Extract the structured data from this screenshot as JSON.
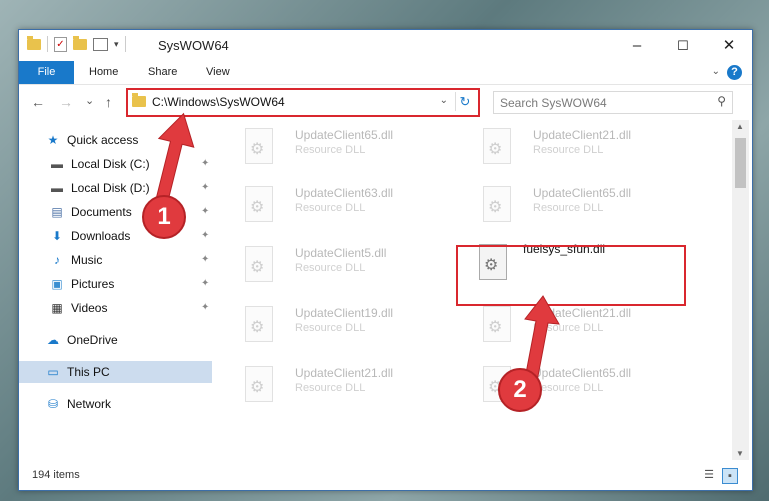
{
  "window": {
    "title": "SysWOW64",
    "minimize_glyph": "–",
    "maximize_glyph": "☐",
    "close_glyph": "✕"
  },
  "quick_access_toolbar": {
    "icons": [
      "folder-icon",
      "properties-check-icon",
      "new-folder-icon",
      "properties-icon",
      "customize-dropdown-icon"
    ]
  },
  "ribbon": {
    "tabs": [
      "File",
      "Home",
      "Share",
      "View"
    ],
    "help_glyph": "?",
    "expand_glyph": "⌄"
  },
  "navigation": {
    "back_glyph": "←",
    "forward_glyph": "→",
    "recent_glyph": "⌄",
    "up_glyph": "↑",
    "address": "C:\\Windows\\SysWOW64",
    "refresh_glyph": "↻",
    "search_placeholder": "Search SysWOW64",
    "search_glyph": "⚲"
  },
  "sidebar": {
    "items": [
      {
        "label": "Quick access",
        "icon": "star-icon",
        "glyph": "★",
        "pinned": false,
        "level": 0
      },
      {
        "label": "Local Disk (C:)",
        "icon": "drive-icon",
        "glyph": "▬",
        "pinned": true,
        "level": 1
      },
      {
        "label": "Local Disk (D:)",
        "icon": "drive-icon",
        "glyph": "▬",
        "pinned": true,
        "level": 1
      },
      {
        "label": "Documents",
        "icon": "documents-icon",
        "glyph": "▤",
        "pinned": true,
        "level": 1
      },
      {
        "label": "Downloads",
        "icon": "downloads-icon",
        "glyph": "⬇",
        "pinned": true,
        "level": 1
      },
      {
        "label": "Music",
        "icon": "music-icon",
        "glyph": "♪",
        "pinned": true,
        "level": 1
      },
      {
        "label": "Pictures",
        "icon": "pictures-icon",
        "glyph": "▣",
        "pinned": true,
        "level": 1
      },
      {
        "label": "Videos",
        "icon": "videos-icon",
        "glyph": "▦",
        "pinned": true,
        "level": 1
      },
      {
        "label": "OneDrive",
        "icon": "onedrive-icon",
        "glyph": "☁",
        "pinned": false,
        "level": 0
      },
      {
        "label": "This PC",
        "icon": "pc-icon",
        "glyph": "▭",
        "pinned": false,
        "level": 0,
        "selected": true
      },
      {
        "label": "Network",
        "icon": "network-icon",
        "glyph": "⛁",
        "pinned": false,
        "level": 0
      }
    ],
    "pin_glyph": "📌"
  },
  "files": [
    {
      "name": "UpdateClient65.dll",
      "type": "Resource DLL"
    },
    {
      "name": "UpdateClient21.dll",
      "type": "Resource DLL"
    },
    {
      "name": "UpdateClient63.dll",
      "type": "Resource DLL"
    },
    {
      "name": "UpdateClient65.dll",
      "type": "Resource DLL"
    },
    {
      "name": "UpdateClient5.dll",
      "type": "Resource DLL"
    },
    {
      "name": "fuelsys_sfun.dll",
      "type": "",
      "highlighted": true
    },
    {
      "name": "UpdateClient19.dll",
      "type": "Resource DLL"
    },
    {
      "name": "UpdateClient21.dll",
      "type": "Resource DLL"
    },
    {
      "name": "UpdateClient21.dll",
      "type": "Resource DLL"
    },
    {
      "name": "UpdateClient65.dll",
      "type": "Resource DLL"
    }
  ],
  "status": {
    "item_count": "194 items"
  },
  "annotations": {
    "step1": "1",
    "step2": "2",
    "color": "#e03a3e"
  }
}
